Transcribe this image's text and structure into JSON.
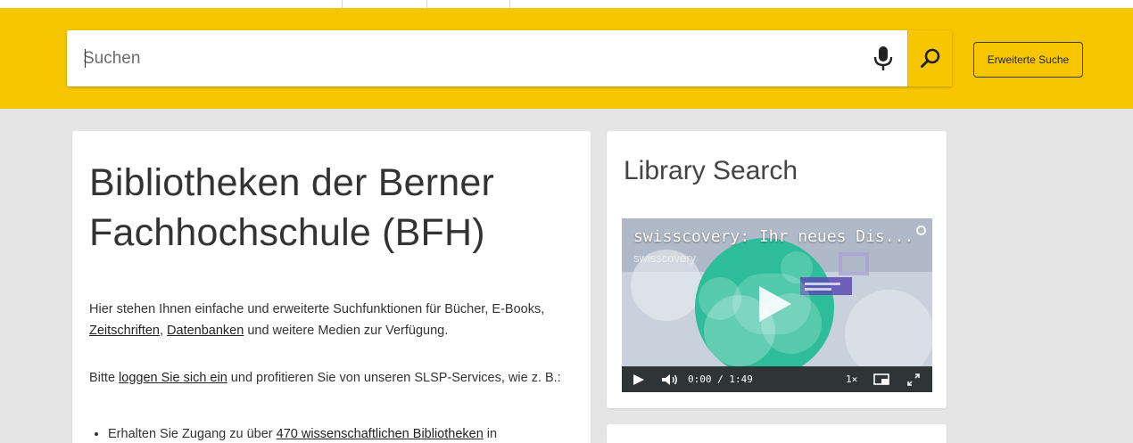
{
  "search": {
    "placeholder": "Suchen",
    "advanced_label": "Erweiterte Suche"
  },
  "main": {
    "title": "Bibliotheken der Berner Fachhochschule (BFH)",
    "intro_start": "Hier stehen Ihnen einfache und erweiterte Suchfunktionen für Bücher, E-Books, ",
    "link_journals": "Zeitschriften",
    "sep1": ", ",
    "link_databases": "Datenbanken",
    "intro_end": " und weitere Medien zur Verfügung.",
    "login_start": "Bitte ",
    "link_login": "loggen Sie sich ein",
    "login_end": " und profitieren Sie von unseren SLSP-Services, wie z. B.:",
    "bullet1_start": "Erhalten Sie Zugang zu über ",
    "bullet1_link": "470 wissenschaftlichen Bibliotheken",
    "bullet1_end": " in"
  },
  "side": {
    "title": "Library Search",
    "video": {
      "title": "swisscovery: Ihr neues Dis...",
      "channel": "swisscovery",
      "time": "0:00 / 1:49",
      "speed": "1×"
    }
  },
  "colors": {
    "brand_yellow": "#f7c600",
    "video_green": "#2ebd9a"
  }
}
